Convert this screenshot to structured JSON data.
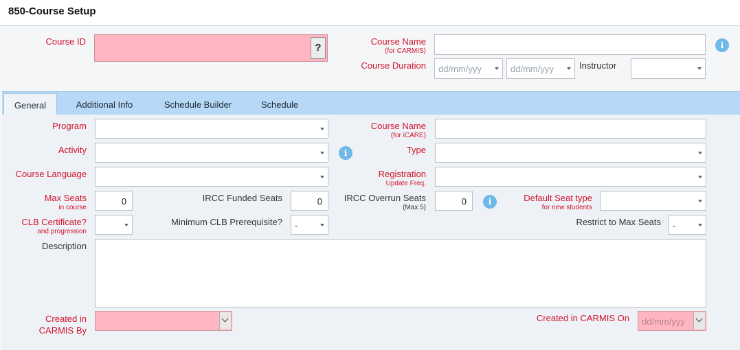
{
  "window": {
    "title": "850-Course Setup"
  },
  "header": {
    "course_id": {
      "label": "Course ID",
      "value": "",
      "help_button": "?"
    },
    "course_name_carmis": {
      "label": "Course Name",
      "sublabel": "(for CARMIS)",
      "value": ""
    },
    "course_duration": {
      "label": "Course Duration",
      "start_placeholder": "dd/mm/yyy",
      "end_placeholder": "dd/mm/yyy"
    },
    "instructor": {
      "label": "Instructor",
      "value": ""
    }
  },
  "tabs": [
    {
      "label": "General",
      "active": true
    },
    {
      "label": "Additional Info",
      "active": false
    },
    {
      "label": "Schedule Builder",
      "active": false
    },
    {
      "label": "Schedule",
      "active": false
    }
  ],
  "general": {
    "program": {
      "label": "Program",
      "value": ""
    },
    "course_name_icare": {
      "label": "Course Name",
      "sublabel": "(for iCARE)",
      "value": ""
    },
    "activity": {
      "label": "Activity",
      "value": ""
    },
    "type": {
      "label": "Type",
      "value": ""
    },
    "course_language": {
      "label": "Course Language",
      "value": ""
    },
    "registration": {
      "label": "Registration",
      "sublabel": "Update Freq.",
      "value": ""
    },
    "max_seats": {
      "label": "Max Seats",
      "sublabel": "in course",
      "value": "0"
    },
    "ircc_funded_seats": {
      "label": "IRCC Funded Seats",
      "value": "0"
    },
    "ircc_overrun_seats": {
      "label": "IRCC Overrun Seats",
      "sublabel": "(Max 5)",
      "value": "0"
    },
    "default_seat_type": {
      "label": "Default Seat type",
      "sublabel": "for new students",
      "value": ""
    },
    "clb_certificate": {
      "label": "CLB Certificate?",
      "sublabel": "and progression",
      "value": ""
    },
    "min_clb_prereq": {
      "label": "Minimum CLB Prerequisite?",
      "value": "-"
    },
    "restrict_max_seats": {
      "label": "Restrict to Max Seats",
      "value": "-"
    },
    "description": {
      "label": "Description",
      "value": ""
    },
    "created_by": {
      "label_line1": "Created in",
      "label_line2": "CARMIS By",
      "value": ""
    },
    "created_on": {
      "label": "Created in CARMIS On",
      "placeholder": "dd/mm/yyy"
    }
  },
  "icons": {
    "info": "info-icon",
    "info_glyph": "i"
  },
  "colors": {
    "required_label": "#d0132c",
    "required_field": "#ffb6c1",
    "tab_bar": "#b7d9f7",
    "info_icon": "#6fb8ea"
  }
}
